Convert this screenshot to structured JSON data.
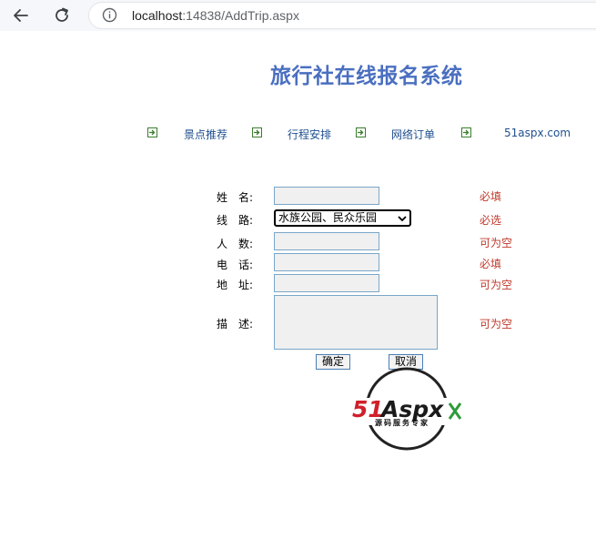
{
  "browser": {
    "url_host": "localhost",
    "url_rest": ":14838/AddTrip.aspx"
  },
  "page": {
    "title": "旅行社在线报名系统"
  },
  "nav": {
    "items": [
      {
        "label": "景点推荐"
      },
      {
        "label": "行程安排"
      },
      {
        "label": "网络订单"
      },
      {
        "label": "51aspx.com"
      }
    ]
  },
  "form": {
    "name": {
      "label_a": "姓",
      "label_b": "名:",
      "value": "",
      "hint": "必填"
    },
    "route": {
      "label_a": "线",
      "label_b": "路:",
      "selected": "水族公园、民众乐园",
      "hint": "必选"
    },
    "people": {
      "label_a": "人",
      "label_b": "数:",
      "value": "",
      "hint": "可为空"
    },
    "phone": {
      "label_a": "电",
      "label_b": "话:",
      "value": "",
      "hint": "必填"
    },
    "address": {
      "label_a": "地",
      "label_b": "址:",
      "value": "",
      "hint": "可为空"
    },
    "desc": {
      "label_a": "描",
      "label_b": "述:",
      "value": "",
      "hint": "可为空"
    },
    "confirm_label": "确定",
    "cancel_label": "取消"
  },
  "logo": {
    "brand": "51Aspx",
    "tagline": "源码服务专家"
  },
  "colors": {
    "title": "#4a6fc0",
    "nav_link": "#1f4f8f",
    "nav_arrow": "#3a7d2c",
    "hint": "#c0392b",
    "field_border": "#7aa6c8",
    "logo_red": "#d0202a",
    "logo_green": "#2e9b3a"
  },
  "icons": {
    "back": "arrow-left-icon",
    "reload": "reload-icon",
    "info": "info-circle-icon",
    "nav": "arrow-right-box-icon"
  }
}
